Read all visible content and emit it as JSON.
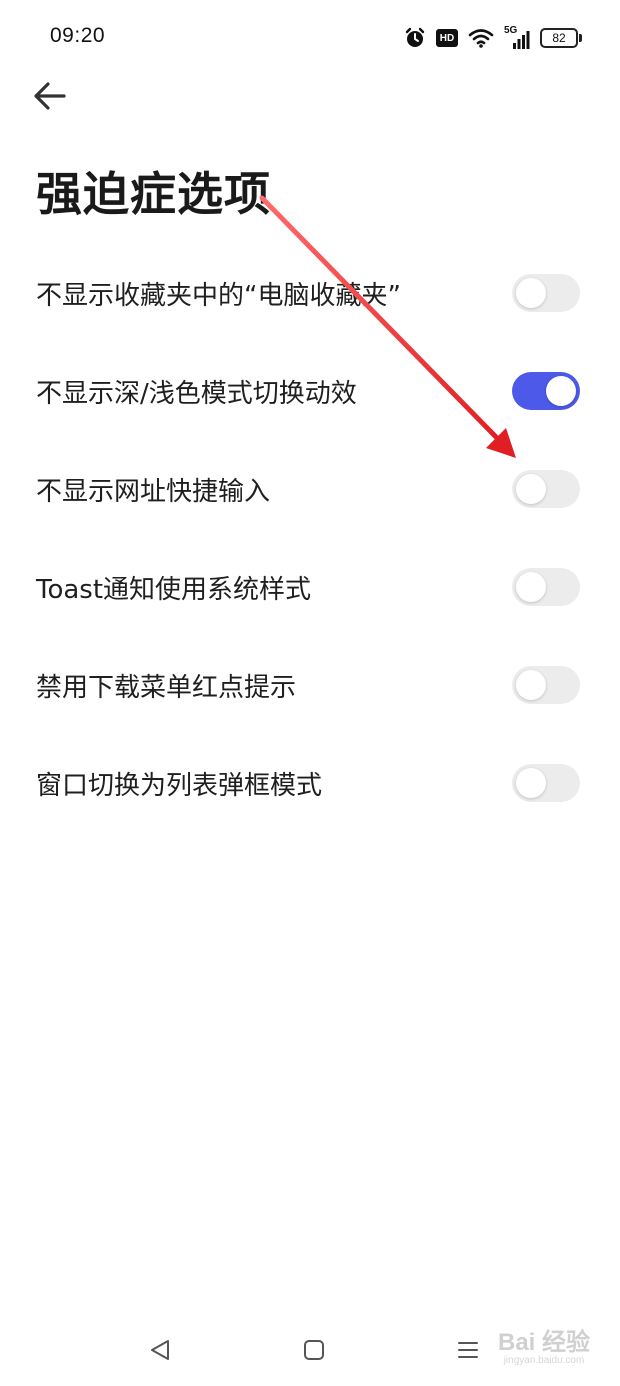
{
  "status_bar": {
    "time": "09:20",
    "icons": [
      "alarm-icon",
      "hd-icon",
      "wifi-icon",
      "signal-5g-icon",
      "battery-icon"
    ],
    "hd_label": "HD",
    "network_label": "5G",
    "battery_level": "82"
  },
  "header": {
    "back_icon": "arrow-left-icon",
    "title": "强迫症选项"
  },
  "settings": [
    {
      "label": "不显示收藏夹中的“电脑收藏夹”",
      "enabled": false
    },
    {
      "label": "不显示深/浅色模式切换动效",
      "enabled": true
    },
    {
      "label": "不显示网址快捷输入",
      "enabled": false
    },
    {
      "label": "Toast通知使用系统样式",
      "enabled": false
    },
    {
      "label": "禁用下载菜单红点提示",
      "enabled": false
    },
    {
      "label": "窗口切换为列表弹框模式",
      "enabled": false
    }
  ],
  "nav_bar": {
    "icons": [
      "nav-back-icon",
      "nav-home-icon",
      "nav-menu-icon"
    ]
  },
  "watermark": {
    "main": "Bai 经验",
    "sub": "jingyan.baidu.com"
  },
  "colors": {
    "toggle_on": "#4d59e8",
    "toggle_off": "#ececec",
    "annotation_arrow": "#e8262a"
  }
}
